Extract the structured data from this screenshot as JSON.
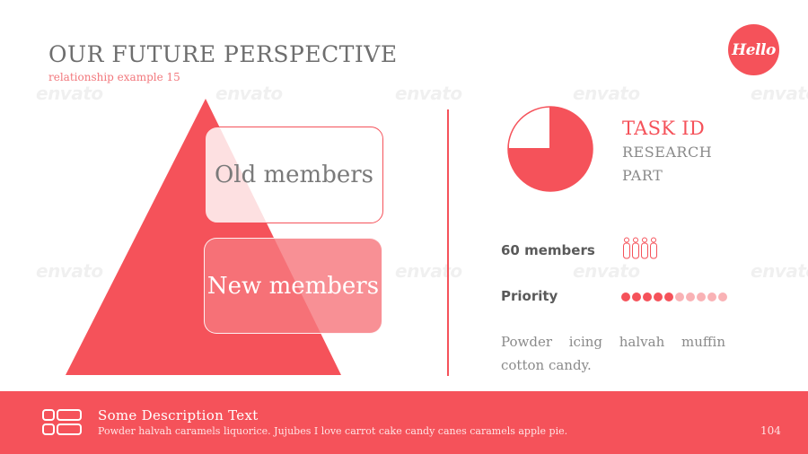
{
  "slide": {
    "title": "OUR FUTURE PERSPECTIVE",
    "subtitle": "relationship example 15",
    "logo_text": "Hello",
    "watermark_text": "envato"
  },
  "pyramid": {
    "old_label": "Old members",
    "new_label": "New members"
  },
  "task": {
    "title": "TASK ID",
    "line1": "RESEARCH",
    "line2": "PART",
    "pie_fraction": 0.75
  },
  "stats": {
    "members_label": "60 members",
    "people_icon_count": 4,
    "priority_label": "Priority",
    "priority_filled": 5,
    "priority_total": 10,
    "description": "Powder icing halvah muffin cotton candy."
  },
  "footer": {
    "title": "Some Description Text",
    "text": "Powder halvah caramels liquorice. Jujubes I love carrot cake candy canes caramels apple pie.",
    "page_number": "104"
  },
  "colors": {
    "accent": "#f5525a",
    "accent_light": "#f7787e",
    "dot_light": "#f9b2b5",
    "text_gray": "#6e6e6e"
  }
}
